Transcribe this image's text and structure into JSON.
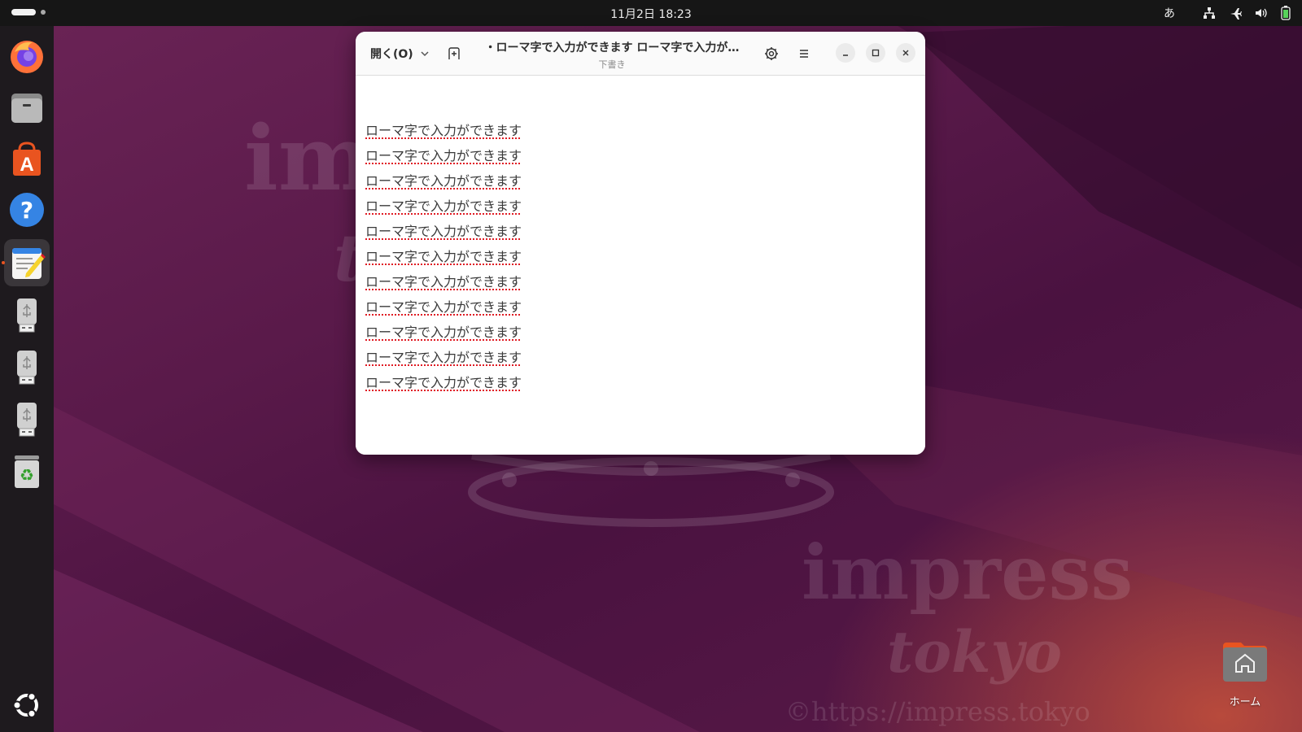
{
  "topbar": {
    "clock": "11月2日  18:23",
    "ime_indicator": "あ",
    "tray_icons": [
      "network-icon",
      "airplane-mode-icon",
      "volume-icon",
      "battery-icon"
    ]
  },
  "dock": {
    "items": [
      {
        "name": "firefox",
        "icon": "firefox-icon",
        "active": false
      },
      {
        "name": "files",
        "icon": "files-icon",
        "active": false
      },
      {
        "name": "app-center",
        "icon": "app-center-icon",
        "active": false
      },
      {
        "name": "help",
        "icon": "help-icon",
        "active": false
      },
      {
        "name": "text-editor",
        "icon": "text-editor-icon",
        "active": true
      },
      {
        "name": "usb-drive-1",
        "icon": "usb-drive-icon",
        "active": false
      },
      {
        "name": "usb-drive-2",
        "icon": "usb-drive-icon",
        "active": false
      },
      {
        "name": "usb-drive-3",
        "icon": "usb-drive-icon",
        "active": false
      },
      {
        "name": "trash",
        "icon": "trash-icon",
        "active": false
      }
    ],
    "show_apps_icon": "ubuntu-logo-icon"
  },
  "window": {
    "open_label": "開く(O)",
    "title": "・ローマ字で入力ができます ローマ字で入力が…",
    "subtitle": "下書き",
    "lines": [
      "ローマ字で入力ができます",
      "ローマ字で入力ができます",
      "ローマ字で入力ができます",
      "ローマ字で入力ができます",
      "ローマ字で入力ができます",
      "ローマ字で入力ができます",
      "ローマ字で入力ができます",
      "ローマ字で入力ができます",
      "ローマ字で入力ができます",
      "ローマ字で入力ができます",
      "ローマ字で入力ができます"
    ]
  },
  "wallpaper": {
    "watermark_1": "impress",
    "watermark_2": "tokyo",
    "watermark_url": "©https://impress.tokyo"
  },
  "desktop": {
    "home_label": "ホーム"
  },
  "colors": {
    "accent": "#e95420",
    "spell_underline": "#e01b24",
    "topbar_bg": "#161616",
    "dock_bg": "#1e1a1e"
  }
}
